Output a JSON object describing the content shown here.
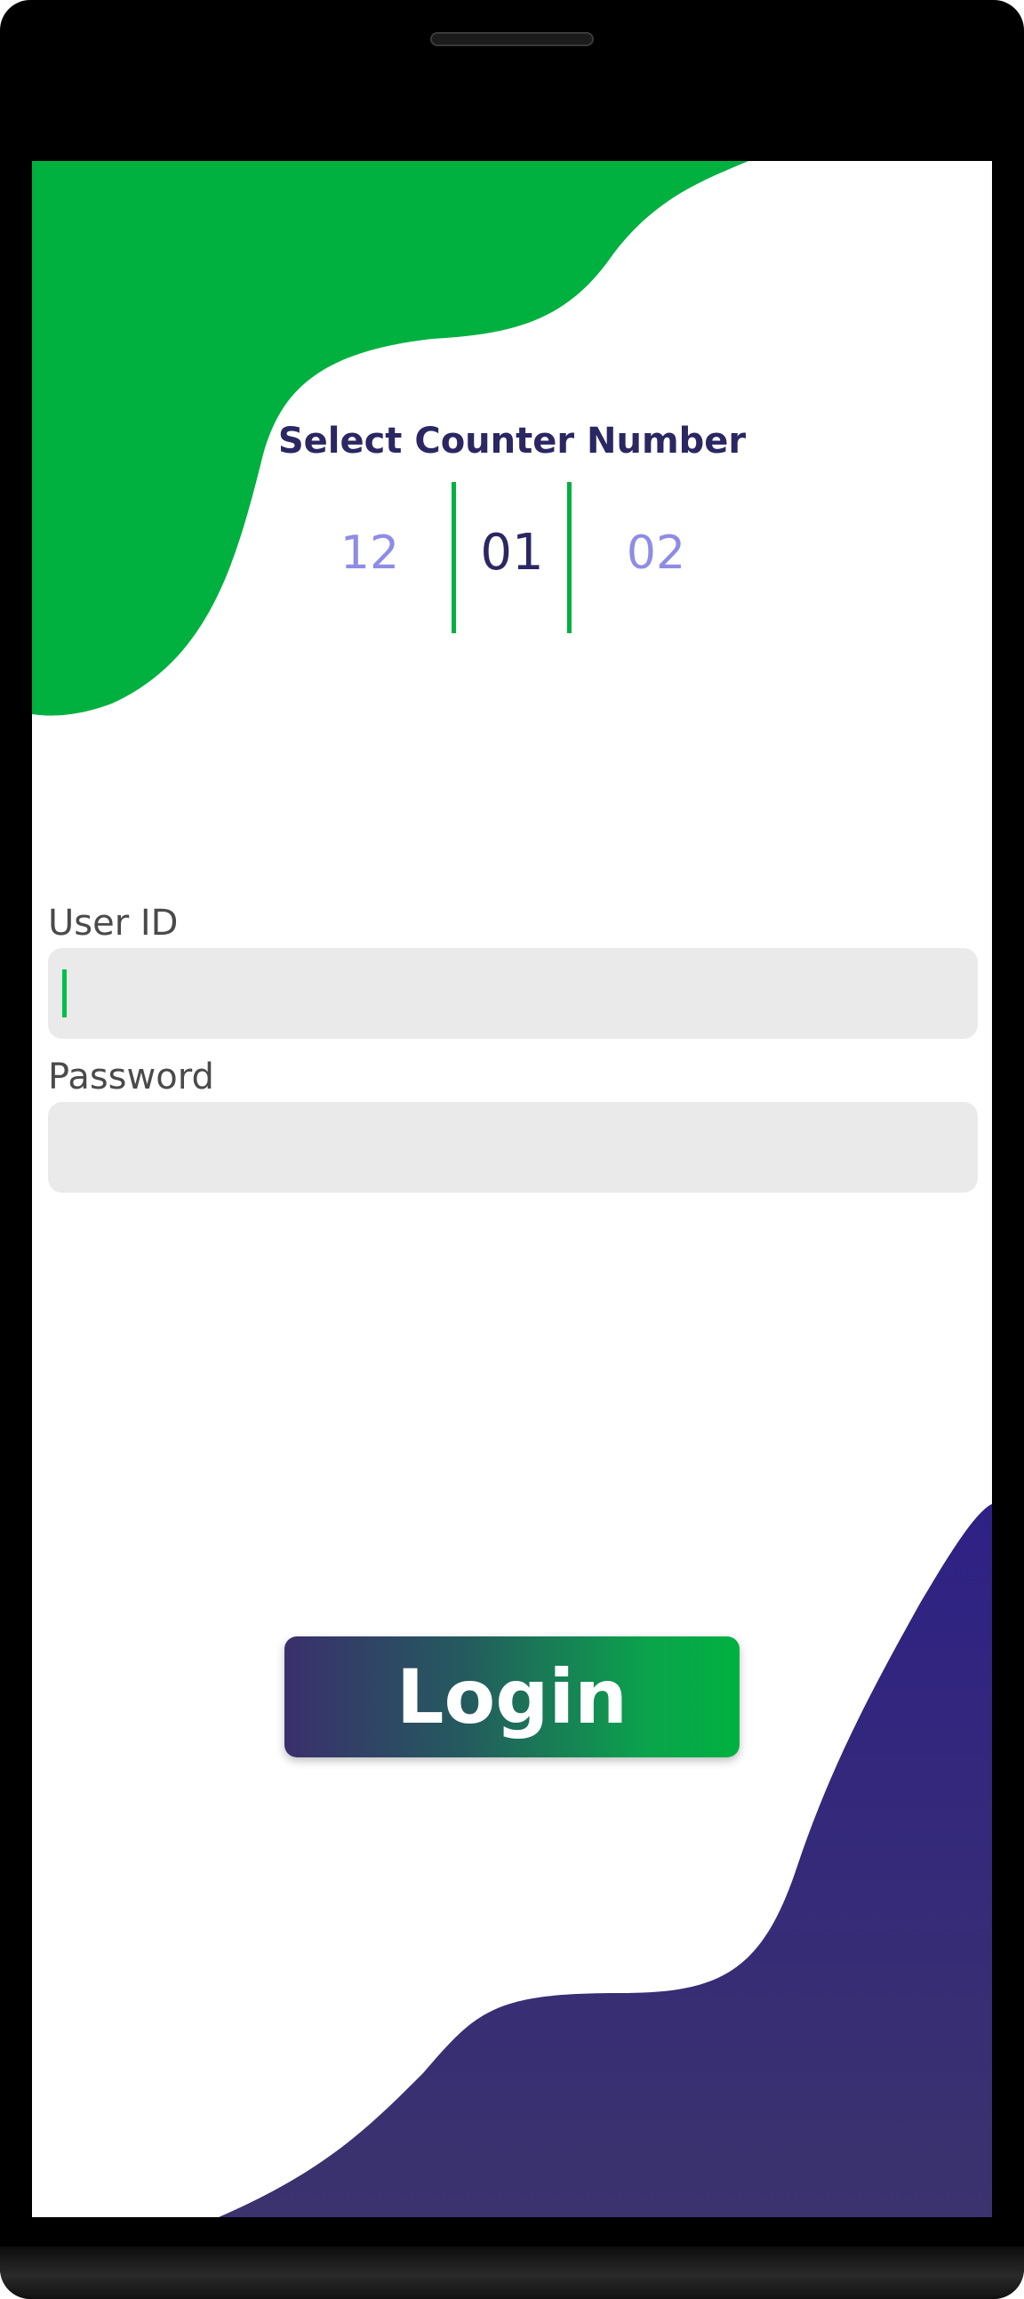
{
  "colors": {
    "accent_green": "#00b140",
    "accent_purple": "#2e2185",
    "title_text": "#2b2763",
    "field_background": "#eaeaea"
  },
  "counter": {
    "title": "Select Counter Number",
    "options": [
      "12",
      "01",
      "02"
    ],
    "selected": "01"
  },
  "form": {
    "user_id": {
      "label": "User ID",
      "value": ""
    },
    "password": {
      "label": "Password",
      "value": ""
    }
  },
  "login_button": {
    "label": "Login"
  }
}
